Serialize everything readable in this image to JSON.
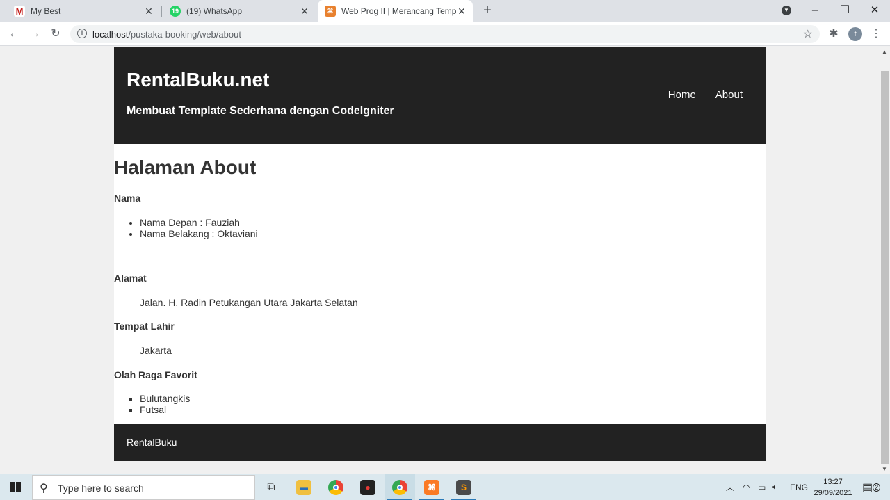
{
  "browser": {
    "tabs": [
      {
        "title": "My Best",
        "icon": "gmail-icon"
      },
      {
        "title": "(19) WhatsApp",
        "icon": "whatsapp-icon",
        "badge": "19"
      },
      {
        "title": "Web Prog II | Merancang Templa",
        "icon": "codeigniter-icon"
      }
    ],
    "new_tab_label": "+",
    "url_host": "localhost",
    "url_path": "/pustaka-booking/web/about",
    "profile_initial": "f"
  },
  "site": {
    "title": "RentalBuku.net",
    "subtitle": "Membuat Template Sederhana dengan CodeIgniter",
    "nav": [
      {
        "label": "Home"
      },
      {
        "label": "About"
      }
    ],
    "footer": "RentalBuku"
  },
  "about": {
    "heading": "Halaman About",
    "nama_label": "Nama",
    "nama_items": [
      "Nama Depan : Fauziah",
      "Nama Belakang : Oktaviani"
    ],
    "alamat_label": "Alamat",
    "alamat_value": "Jalan. H. Radin Petukangan Utara Jakarta Selatan",
    "tempat_lahir_label": "Tempat Lahir",
    "tempat_lahir_value": "Jakarta",
    "olahraga_label": "Olah Raga Favorit",
    "olahraga_items": [
      "Bulutangkis",
      "Futsal"
    ]
  },
  "taskbar": {
    "search_placeholder": "Type here to search",
    "language": "ENG",
    "time": "13:27",
    "date": "29/09/2021",
    "notification_count": "2"
  },
  "colors": {
    "header_bg": "#222222",
    "tab_strip": "#dee1e6",
    "taskbar": "#dbe8ee"
  }
}
